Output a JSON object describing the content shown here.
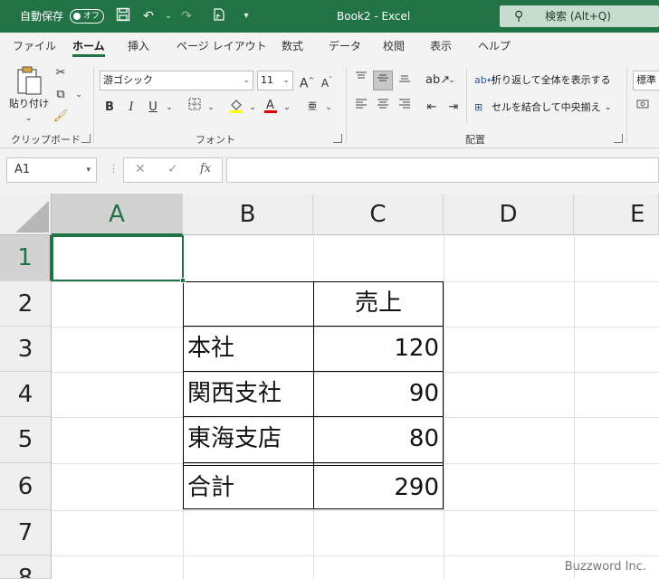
{
  "titlebar": {
    "autosave_label": "自動保存",
    "autosave_state": "オフ",
    "title": "Book2 - Excel",
    "search_placeholder": "検索 (Alt+Q)"
  },
  "tabs": [
    "ファイル",
    "ホーム",
    "挿入",
    "ページ レイアウト",
    "数式",
    "データ",
    "校閲",
    "表示",
    "ヘルプ"
  ],
  "active_tab": "ホーム",
  "ribbon": {
    "clipboard": {
      "paste_label": "貼り付け",
      "group_label": "クリップボード"
    },
    "font": {
      "font_name": "游ゴシック",
      "font_size": "11",
      "group_label": "フォント"
    },
    "alignment": {
      "wrap_text": "折り返して全体を表示する",
      "merge_center": "セルを結合して中央揃え",
      "group_label": "配置"
    },
    "number": {
      "format_label": "標準"
    }
  },
  "formula_bar": {
    "name_box": "A1",
    "content": ""
  },
  "columns": [
    "A",
    "B",
    "C",
    "D",
    "E"
  ],
  "selected_column": "A",
  "rows": [
    "1",
    "2",
    "3",
    "4",
    "5",
    "6",
    "7",
    "8"
  ],
  "selected_row": "1",
  "cells": {
    "C2": "売上",
    "B3": "本社",
    "C3": "120",
    "B4": "関西支社",
    "C4": "90",
    "B5": "東海支店",
    "C5": "80",
    "B6": "合計",
    "C6": "290"
  },
  "watermark": "Buzzword Inc.",
  "colors": {
    "accent": "#217346",
    "selection": "#217346"
  }
}
